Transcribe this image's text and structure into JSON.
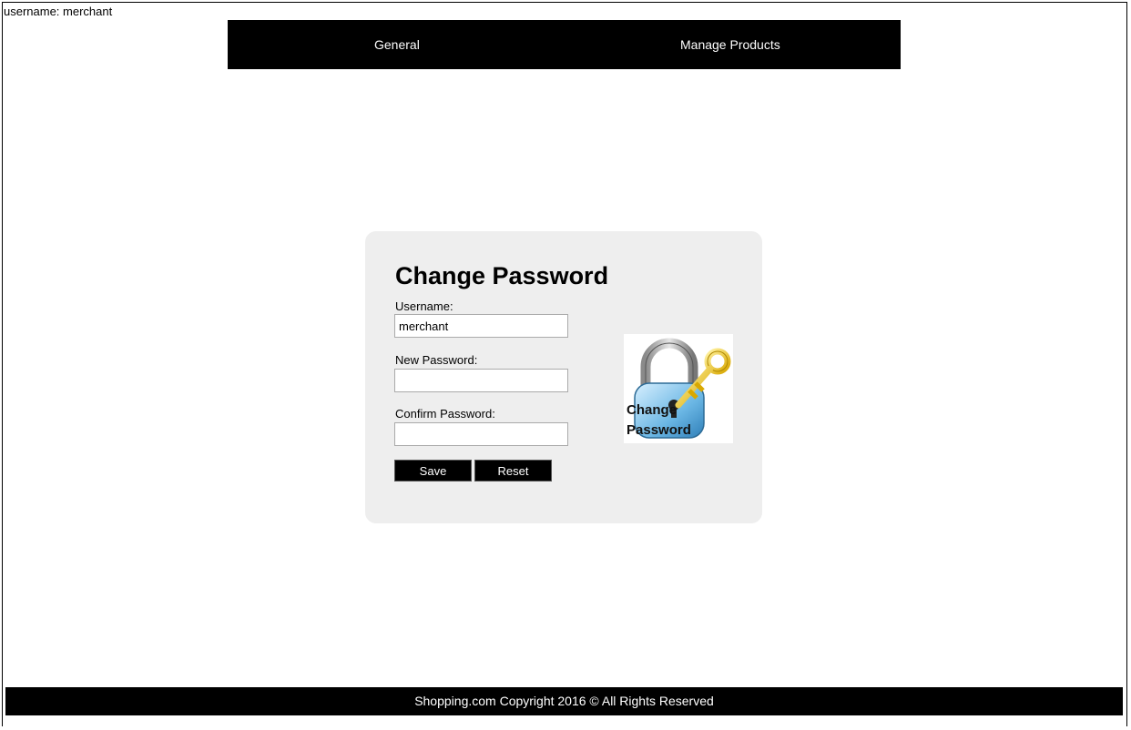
{
  "header": {
    "username_line": "username: merchant"
  },
  "nav": {
    "items": [
      "General",
      "Manage Products"
    ]
  },
  "form": {
    "title": "Change Password",
    "username_label": "Username:",
    "username_value": "merchant",
    "new_password_label": "New Password:",
    "confirm_password_label": "Confirm Password:",
    "save_label": "Save",
    "reset_label": "Reset"
  },
  "image": {
    "icon": "lock-key-icon",
    "caption_line1": "Change",
    "caption_line2": "Password"
  },
  "footer": {
    "text": "Shopping.com Copyright 2016 © All Rights Reserved"
  },
  "colors": {
    "nav_bg": "#000000",
    "panel_bg": "#eeeeee",
    "key": "#f2cf3a"
  }
}
